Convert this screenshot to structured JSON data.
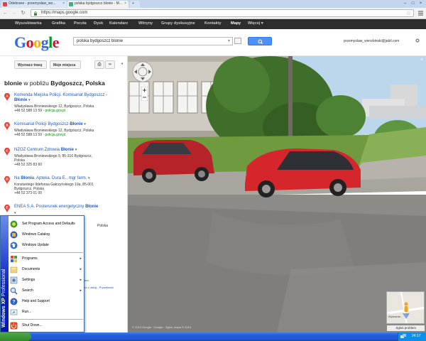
{
  "browser": {
    "tabs": [
      {
        "title": "Odebrane - przemyslaw_wo..."
      },
      {
        "title": "polska bydgoszcz blonie - M..."
      }
    ],
    "url": "https://maps.google.com"
  },
  "gbar": {
    "items": [
      "Wyszukiwarka",
      "Grafika",
      "Poczta",
      "Dysk",
      "Kalendarz",
      "Witryny",
      "Grupy dyskusyjne",
      "Kontakty",
      "Mapy",
      "Więcej ▾"
    ],
    "active": "Mapy"
  },
  "header": {
    "logo": "Google",
    "search_value": "polska bydgoszcz blonie",
    "user_email": "przemyslaw_wierzbinski@jabil.com"
  },
  "left_panel": {
    "buttons": {
      "directions": "Wyznacz trasę",
      "my_places": "Moje miejsca"
    },
    "title": {
      "bold1": "blonie",
      "mid": " w pobliżu ",
      "bold2": "Bydgoszcz, Polska"
    },
    "results": [
      {
        "letter": "A",
        "name_pre": "Komenda Miejska Policji. Komisariat Bydgoszcz - ",
        "name_bold": "Błonie",
        "address": "Władysława Broniewskiego 12, Bydgoszcz, Polska",
        "phone": "+48 52 588 13 59",
        "link": "policja.gov.pl"
      },
      {
        "letter": "B",
        "name_pre": "Komisariat Policji Bydgoszcz-",
        "name_bold": "Błonie",
        "address": "Władysława Broniewskiego 12, Bydgoszcz, Polska",
        "phone": "+48 52 588 13 59",
        "link": "policja.gov.pl"
      },
      {
        "letter": "C",
        "name_pre": "NZOZ Centrum Zdrowia ",
        "name_bold": "Błonie",
        "address": "Władysława Broniewskiego 9, 85-316 Bydgoszcz,",
        "address2": "Polska",
        "phone": "+48 52 325 83 60"
      },
      {
        "letter": "D",
        "name_pre": "Na ",
        "name_bold": "Błoniu",
        "name_post": ". Apteka. Dura E., mgr farm.",
        "address": "Konstantego Ildefonsa Gałczyńskiego 19a, 85-001",
        "address2": "Bydgoszcz, Polska",
        "phone": "+48 52 373 01 00"
      },
      {
        "letter": "E",
        "name_pre": "ENEA S.A. Posterunek energetyczny ",
        "name_bold": "Błonie"
      }
    ],
    "partial_text": "Polska",
    "partial_link1": "tkoc",
    "partial_link2": "ez z usług - Prywatność"
  },
  "map": {
    "copyright": "© 2013 Google · Google - Zgłoś, mapa © 2013",
    "minimap_label": "Zgłoś problem",
    "minimap_street": "Wybranie.."
  },
  "start_menu": {
    "strip_bold": "Windows XP",
    "strip_normal": " Professional",
    "items": [
      {
        "label": "Set Program Access and Defaults",
        "icon": "program-access-icon"
      },
      {
        "label": "Windows Catalog",
        "icon": "windows-catalog-icon"
      },
      {
        "label": "Windows Update",
        "icon": "windows-update-icon"
      },
      {
        "label": "Programs",
        "icon": "programs-icon",
        "sub": true
      },
      {
        "label": "Documents",
        "icon": "documents-icon",
        "sub": true
      },
      {
        "label": "Settings",
        "icon": "settings-icon",
        "sub": true
      },
      {
        "label": "Search",
        "icon": "search-icon",
        "sub": true
      },
      {
        "label": "Help and Support",
        "icon": "help-icon"
      },
      {
        "label": "Run...",
        "icon": "run-icon"
      },
      {
        "label": "Shut Down...",
        "icon": "shutdown-icon"
      }
    ]
  },
  "taskbar": {
    "clock": "24:17"
  },
  "colors": {
    "link": "#1a5bc4",
    "marker": "#e0483e",
    "xp_blue": "#245edb",
    "search_blue": "#4d90fe"
  }
}
